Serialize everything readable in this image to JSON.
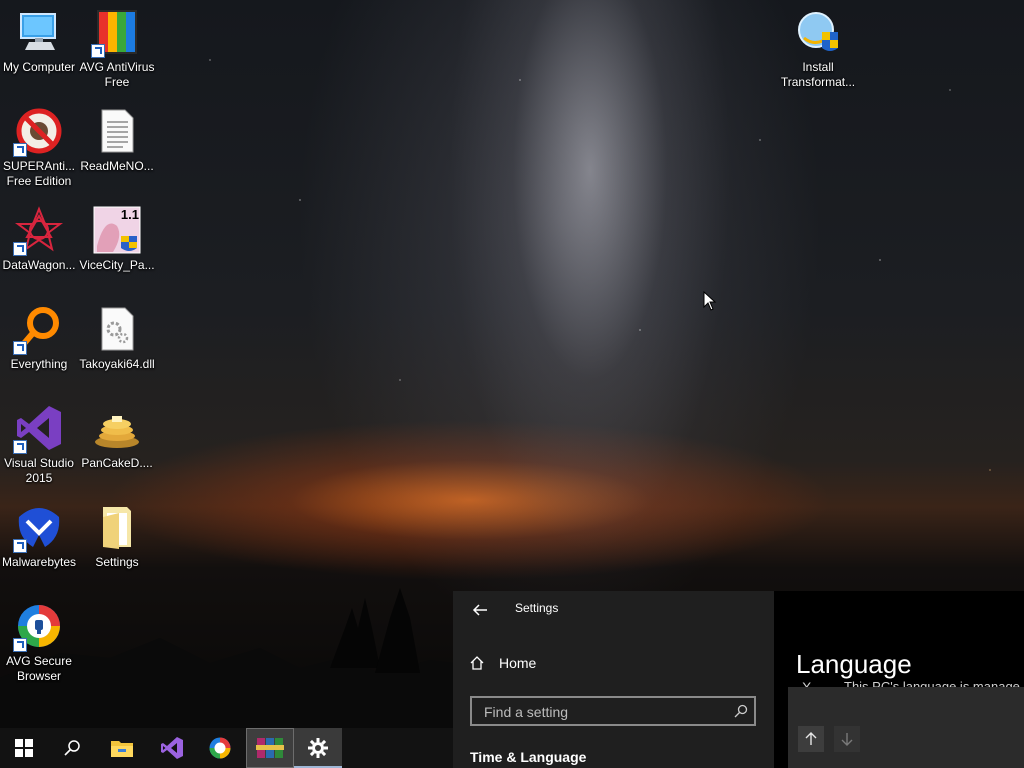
{
  "desktop": {
    "icons": [
      {
        "label": "My Computer",
        "icon": "computer-icon"
      },
      {
        "label": "AVG AntiVirus Free",
        "icon": "avg-antivirus-icon"
      },
      {
        "label": "Install Transformat...",
        "icon": "installer-icon"
      },
      {
        "label": "SUPERAnti... Free Edition",
        "icon": "superantispyware-icon"
      },
      {
        "label": "ReadMeNO...",
        "icon": "text-document-icon"
      },
      {
        "label": "DataWagon...",
        "icon": "datawagon-icon"
      },
      {
        "label": "ViceCity_Pa...",
        "icon": "vicecity-installer-icon",
        "badge": "1.1"
      },
      {
        "label": "Everything",
        "icon": "everything-search-icon"
      },
      {
        "label": "Takoyaki64.dll",
        "icon": "dll-file-icon"
      },
      {
        "label": "Visual Studio 2015",
        "icon": "visual-studio-icon"
      },
      {
        "label": "PanCakeD....",
        "icon": "pancake-icon"
      },
      {
        "label": "Malwarebytes",
        "icon": "malwarebytes-icon"
      },
      {
        "label": "Settings",
        "icon": "folder-icon"
      },
      {
        "label": "AVG Secure Browser",
        "icon": "avg-secure-browser-icon"
      }
    ]
  },
  "settings": {
    "window_title": "Settings",
    "home_label": "Home",
    "search_placeholder": "Find a setting",
    "section_heading": "Time & Language",
    "page_title": "Language",
    "managed_notice": "This PC's language is manage",
    "dismiss_glyph": "X"
  },
  "taskbar": {
    "items": [
      "start-icon",
      "search-icon",
      "file-explorer-icon",
      "visual-studio-icon",
      "avg-secure-browser-icon",
      "winrar-icon",
      "settings-gear-icon"
    ],
    "active_item": "settings-gear-icon",
    "running_item": "winrar-icon"
  },
  "colors": {
    "taskbar": "#121212",
    "settings_pane": "#1f1f1f",
    "language_pane": "#000000",
    "visual_studio": "#7a3fc2",
    "malwarebytes": "#1f4fd6"
  }
}
